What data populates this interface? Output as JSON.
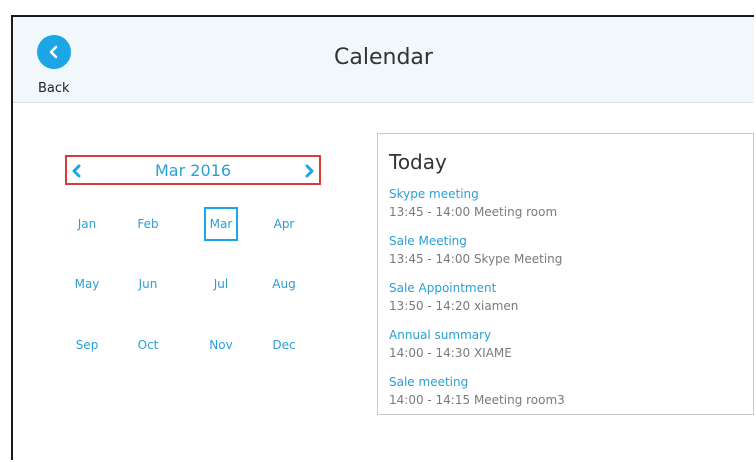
{
  "header": {
    "back_label": "Back",
    "title": "Calendar"
  },
  "calendar": {
    "current_month": "Mar 2016",
    "months": [
      "Jan",
      "Feb",
      "Mar",
      "Apr",
      "May",
      "Jun",
      "Jul",
      "Aug",
      "Sep",
      "Oct",
      "Nov",
      "Dec"
    ],
    "selected_month": "Mar"
  },
  "today": {
    "title": "Today",
    "events": [
      {
        "name": "Skype meeting",
        "detail": "13:45 - 14:00 Meeting room"
      },
      {
        "name": "Sale Meeting",
        "detail": "13:45 - 14:00 Skype Meeting"
      },
      {
        "name": "Sale Appointment",
        "detail": "13:50 - 14:20 xiamen"
      },
      {
        "name": "Annual summary",
        "detail": "14:00 - 14:30 XIAME"
      },
      {
        "name": "Sale meeting",
        "detail": "14:00 - 14:15 Meeting room3"
      }
    ]
  },
  "colors": {
    "accent": "#1ca6e6",
    "highlight_border": "#d93a3a",
    "header_bg": "#f1f8fc"
  },
  "icons": {
    "back": "chevron-left-circle-icon",
    "prev": "chevron-left-icon",
    "next": "chevron-right-icon"
  }
}
